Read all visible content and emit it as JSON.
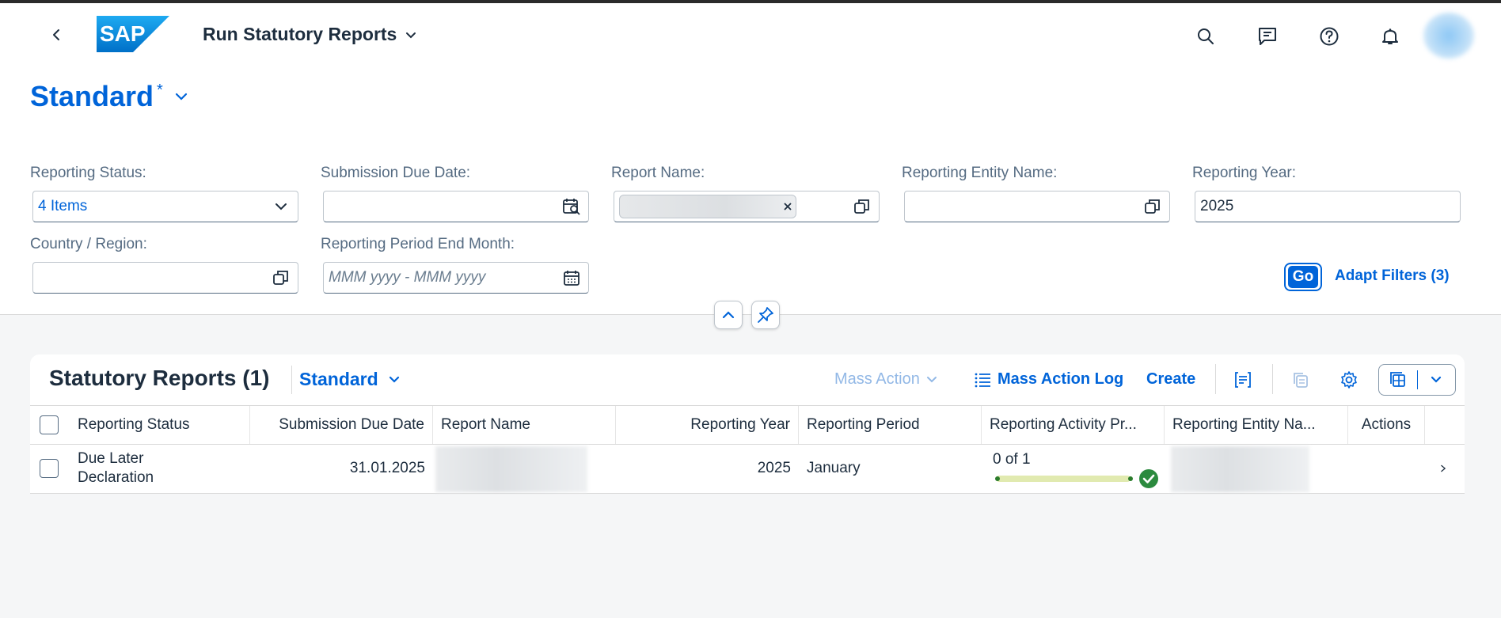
{
  "shell": {
    "app_title": "Run Statutory Reports",
    "logo_text": "SAP"
  },
  "header": {
    "variant_name": "Standard",
    "variant_modified": "*"
  },
  "filters": {
    "reporting_status": {
      "label": "Reporting Status:",
      "value": "4 Items"
    },
    "submission_due_date": {
      "label": "Submission Due Date:",
      "value": ""
    },
    "report_name": {
      "label": "Report Name:"
    },
    "reporting_entity_name": {
      "label": "Reporting Entity Name:",
      "value": ""
    },
    "reporting_year": {
      "label": "Reporting Year:",
      "value": "2025"
    },
    "country_region": {
      "label": "Country / Region:",
      "value": ""
    },
    "reporting_period_end_month": {
      "label": "Reporting Period End Month:",
      "placeholder": "MMM yyyy - MMM yyyy"
    },
    "go_label": "Go",
    "adapt_filters_label": "Adapt Filters (3)"
  },
  "table": {
    "title": "Statutory Reports (1)",
    "variant": "Standard",
    "toolbar": {
      "mass_action": "Mass Action",
      "mass_action_log": "Mass Action Log",
      "create": "Create"
    },
    "columns": [
      "Reporting Status",
      "Submission Due Date",
      "Report Name",
      "Reporting Year",
      "Reporting Period",
      "Reporting Activity Pr...",
      "Reporting Entity Na...",
      "Actions"
    ],
    "rows": [
      {
        "status_line1": "Due Later",
        "status_line2": "Declaration",
        "due_date": "31.01.2025",
        "year": "2025",
        "period": "January",
        "activity_progress": "0 of 1",
        "activity_fraction": 0
      }
    ]
  },
  "colors": {
    "accent": "#0064d9",
    "text": "#1d2d3e",
    "success": "#2b7c2b"
  }
}
